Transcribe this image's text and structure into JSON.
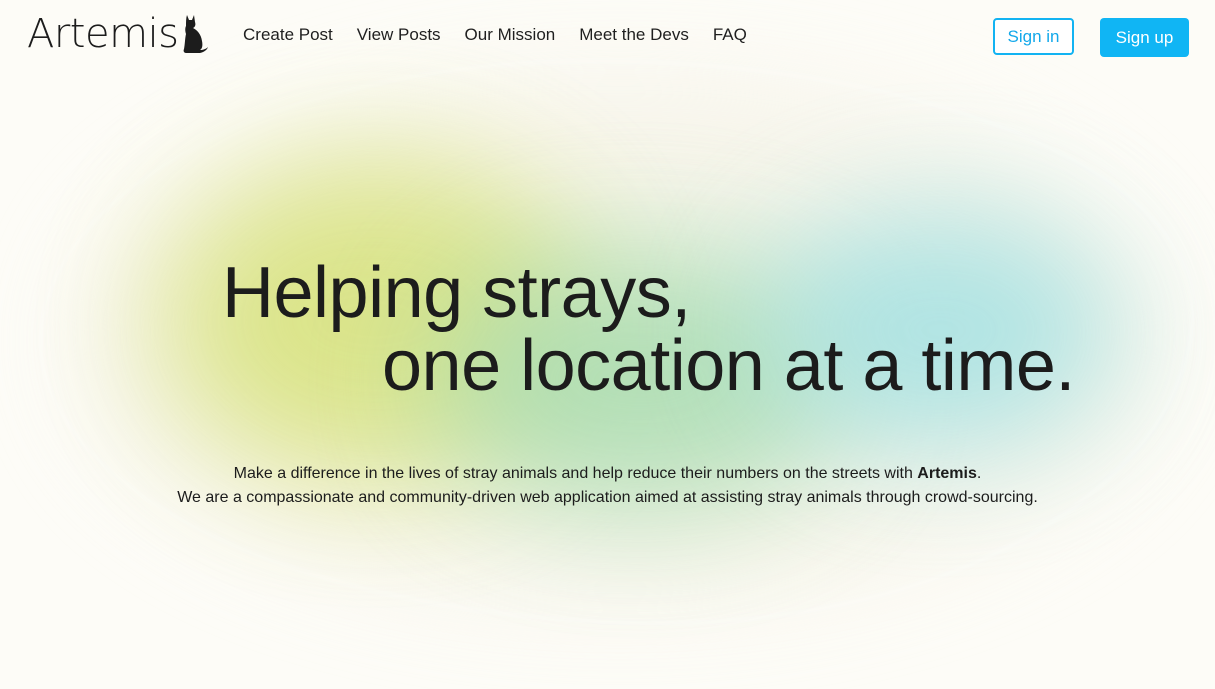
{
  "brand": {
    "name": "Artemis",
    "logo_icon": "cat-silhouette-icon"
  },
  "nav": {
    "links": [
      {
        "label": "Create Post"
      },
      {
        "label": "View Posts"
      },
      {
        "label": "Our Mission"
      },
      {
        "label": "Meet the Devs"
      },
      {
        "label": "FAQ"
      }
    ]
  },
  "auth": {
    "sign_in_label": "Sign in",
    "sign_up_label": "Sign up"
  },
  "hero": {
    "line1": "Helping strays,",
    "line2": "one location at a time."
  },
  "description": {
    "sentence1_before": "Make a difference in the lives of stray animals and help reduce their numbers on the streets with ",
    "sentence1_bold": "Artemis",
    "sentence1_after": ".",
    "sentence2": "We are a compassionate and community-driven web application aimed at assisting stray animals through crowd-sourcing."
  },
  "colors": {
    "accent": "#10b5f4",
    "background": "#fdfcf7",
    "text": "#1c1c1c",
    "blob_yellow": "#d7e27a",
    "blob_green": "#a9dcb0",
    "blob_cyan": "#9fe0e2"
  }
}
